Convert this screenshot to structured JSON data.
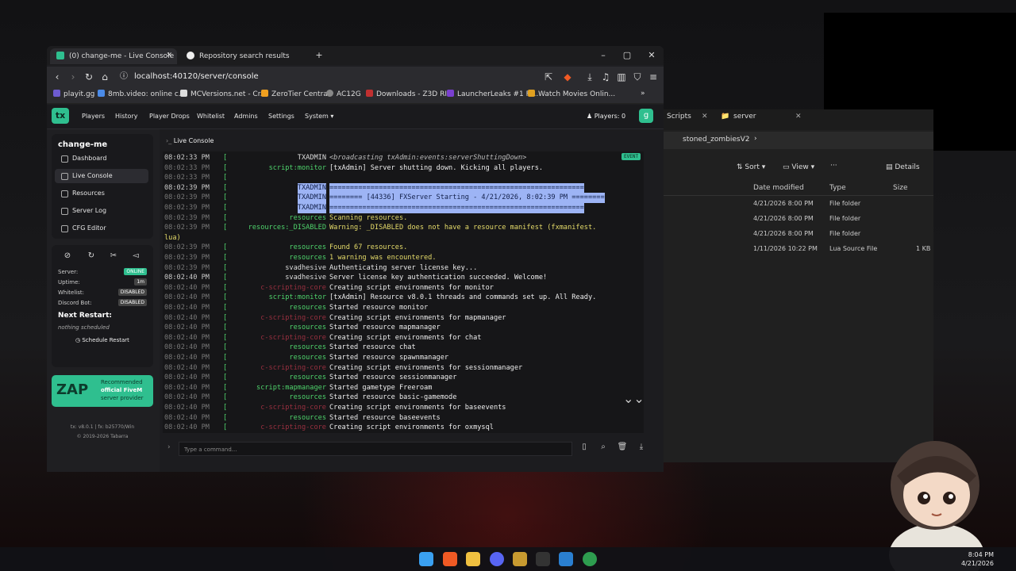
{
  "browser": {
    "tabs": [
      {
        "label": "(0) change-me - Live Console"
      },
      {
        "label": "Repository search results"
      }
    ],
    "url": "localhost:40120/server/console",
    "bookmarks": [
      "playit.gg",
      "8mb.video: online c...",
      "MCVersions.net - Cr...",
      "ZeroTier Central",
      "AC12G",
      "Downloads - Z3D RIP",
      "LauncherLeaks #1 Fi...",
      "Watch Movies Onlin..."
    ]
  },
  "txadmin": {
    "logo": "tx",
    "menu": [
      "Players",
      "History",
      "Player Drops",
      "Whitelist",
      "Admins",
      "Settings",
      "System"
    ],
    "players_label": "Players: 0",
    "user_initial": "g",
    "server_name": "change-me",
    "sidebar_items": [
      "Dashboard",
      "Live Console",
      "Resources",
      "Server Log",
      "CFG Editor"
    ],
    "status": {
      "server_label": "Server:",
      "server_value": "ONLINE",
      "uptime_label": "Uptime:",
      "uptime_value": "1m",
      "whitelist_label": "Whitelist:",
      "whitelist_value": "DISABLED",
      "discord_label": "Discord Bot:",
      "discord_value": "DISABLED"
    },
    "next_restart_label": "Next Restart:",
    "next_restart_value": "nothing scheduled",
    "schedule_button": "Schedule Restart",
    "zap": {
      "brand": "ZAP",
      "text1": "Recommended",
      "text2": "official FiveM",
      "text3": "server provider"
    },
    "version": "tx: v8.0.1 | fx: b25770/Win",
    "copyright": "© 2019-2026 Tabarra",
    "console_title": "Live Console",
    "event_badge": "EVENT",
    "command_placeholder": "Type a command..."
  },
  "console_lines": [
    {
      "t": "08:02:33 PM",
      "s": "TXADMIN",
      "m": "<broadcasting txAdmin:events:serverShuttingDown>",
      "bold": true
    },
    {
      "t": "08:02:33 PM",
      "s": "script:monitor",
      "m": "[txAdmin] Server shutting down. Kicking all players."
    },
    {
      "t": "08:02:33 PM",
      "s": "",
      "m": ""
    },
    {
      "t": "08:02:39 PM",
      "s": "TXADMIN",
      "m": "==============================================================",
      "hl": true,
      "bold": true
    },
    {
      "t": "08:02:39 PM",
      "s": "TXADMIN",
      "m": "======== [44336] FXServer Starting - 4/21/2026, 8:02:39 PM ========",
      "hl": true
    },
    {
      "t": "08:02:39 PM",
      "s": "TXADMIN",
      "m": "==============================================================",
      "hl": true
    },
    {
      "t": "08:02:39 PM",
      "s": "resources",
      "m": "Scanning resources.",
      "y": true
    },
    {
      "t": "08:02:39 PM",
      "s": "resources:_DISABLED",
      "m": "Warning: _DISABLED does not have a resource manifest (fxmanifest.",
      "y": true
    },
    {
      "t": "",
      "s": "",
      "m": "lua)",
      "y": true
    },
    {
      "t": "08:02:39 PM",
      "s": "resources",
      "m": "Found 67 resources.",
      "y": true
    },
    {
      "t": "08:02:39 PM",
      "s": "resources",
      "m": "1 warning was encountered.",
      "y": true
    },
    {
      "t": "08:02:39 PM",
      "s": "svadhesive",
      "m": "Authenticating server license key...",
      "w": true
    },
    {
      "t": "08:02:40 PM",
      "s": "svadhesive",
      "m": "Server license key authentication succeeded. Welcome!",
      "w": true,
      "bold": true
    },
    {
      "t": "08:02:40 PM",
      "s": "c-scripting-core",
      "m": "Creating script environments for monitor",
      "pk": true
    },
    {
      "t": "08:02:40 PM",
      "s": "script:monitor",
      "m": "[txAdmin] Resource v8.0.1 threads and commands set up. All Ready."
    },
    {
      "t": "08:02:40 PM",
      "s": "resources",
      "m": "Started resource monitor"
    },
    {
      "t": "08:02:40 PM",
      "s": "c-scripting-core",
      "m": "Creating script environments for mapmanager",
      "pk": true
    },
    {
      "t": "08:02:40 PM",
      "s": "resources",
      "m": "Started resource mapmanager"
    },
    {
      "t": "08:02:40 PM",
      "s": "c-scripting-core",
      "m": "Creating script environments for chat",
      "pk": true
    },
    {
      "t": "08:02:40 PM",
      "s": "resources",
      "m": "Started resource chat"
    },
    {
      "t": "08:02:40 PM",
      "s": "resources",
      "m": "Started resource spawnmanager"
    },
    {
      "t": "08:02:40 PM",
      "s": "c-scripting-core",
      "m": "Creating script environments for sessionmanager",
      "pk": true
    },
    {
      "t": "08:02:40 PM",
      "s": "resources",
      "m": "Started resource sessionmanager"
    },
    {
      "t": "08:02:40 PM",
      "s": "script:mapmanager",
      "m": "Started gametype Freeroam"
    },
    {
      "t": "08:02:40 PM",
      "s": "resources",
      "m": "Started resource basic-gamemode"
    },
    {
      "t": "08:02:40 PM",
      "s": "c-scripting-core",
      "m": "Creating script environments for baseevents",
      "pk": true
    },
    {
      "t": "08:02:40 PM",
      "s": "resources",
      "m": "Started resource baseevents"
    },
    {
      "t": "08:02:40 PM",
      "s": "c-scripting-core",
      "m": "Creating script environments for oxmysql",
      "pk": true
    }
  ],
  "explorer": {
    "tab_left": "Scripts",
    "tab_right": "server",
    "path": "stoned_zombiesV2",
    "sort": "Sort",
    "view": "View",
    "details": "Details",
    "columns": [
      "Date modified",
      "Type",
      "Size"
    ],
    "rows": [
      {
        "date": "4/21/2026 8:00 PM",
        "type": "File folder",
        "size": ""
      },
      {
        "date": "4/21/2026 8:00 PM",
        "type": "File folder",
        "size": ""
      },
      {
        "date": "4/21/2026 8:00 PM",
        "type": "File folder",
        "size": ""
      },
      {
        "date": "1/11/2026 10:22 PM",
        "type": "Lua Source File",
        "size": "1 KB"
      }
    ]
  },
  "taskbar": {
    "time": "8:04 PM",
    "date": "4/21/2026"
  }
}
